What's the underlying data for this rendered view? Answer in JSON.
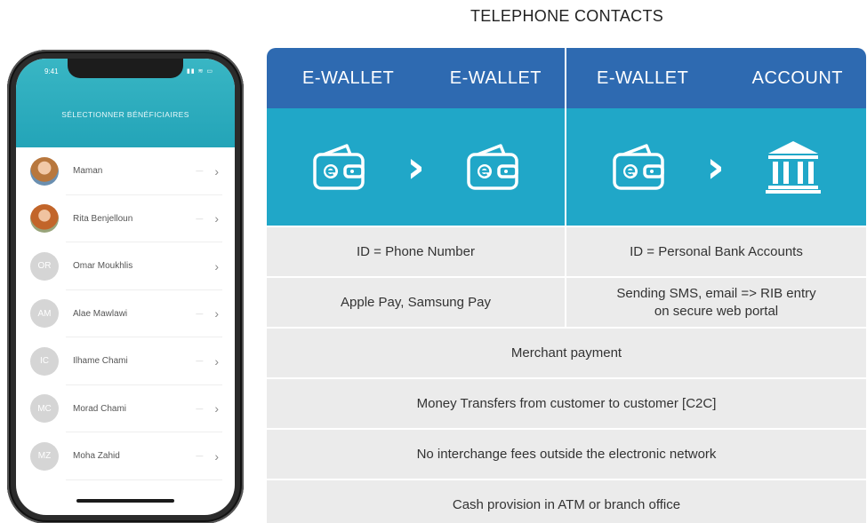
{
  "heading": "TELEPHONE CONTACTS",
  "phone": {
    "time": "9:41",
    "status_icons": "▮▮ ≋ ▭",
    "title": "SÉLECTIONNER BÉNÉFICIAIRES",
    "contacts": [
      {
        "name": "Maman",
        "initials": ""
      },
      {
        "name": "Rita Benjelloun",
        "initials": ""
      },
      {
        "name": "Omar Moukhlis",
        "initials": "OR"
      },
      {
        "name": "Alae Mawlawi",
        "initials": "AM"
      },
      {
        "name": "Ilhame Chami",
        "initials": "IC"
      },
      {
        "name": "Morad Chami",
        "initials": "MC"
      },
      {
        "name": "Moha Zahid",
        "initials": "MZ"
      }
    ],
    "chevron": "›",
    "dash": "—"
  },
  "table": {
    "header": {
      "left_from": "E-WALLET",
      "left_to": "E-WALLET",
      "right_from": "E-WALLET",
      "right_to": "ACCOUNT"
    },
    "arrow": "›",
    "icons": {
      "left_from": "wallet-icon",
      "left_to": "wallet-icon",
      "right_from": "wallet-icon",
      "right_to": "bank-icon"
    },
    "split_rows": [
      {
        "left": "ID = Phone Number",
        "right": "ID = Personal Bank Accounts"
      },
      {
        "left": "Apple Pay, Samsung Pay",
        "right_line1": "Sending SMS, email => RIB entry",
        "right_line2": "on secure web portal"
      }
    ],
    "full_rows": [
      "Merchant payment",
      "Money Transfers from customer to customer [C2C]",
      "No interchange fees outside the electronic network",
      "Cash provision in ATM or branch office"
    ]
  },
  "colors": {
    "header_blue": "#2e6ab1",
    "icon_teal": "#20a7c8",
    "row_gray": "#ebebeb",
    "phone_header": "#23a4b8"
  }
}
